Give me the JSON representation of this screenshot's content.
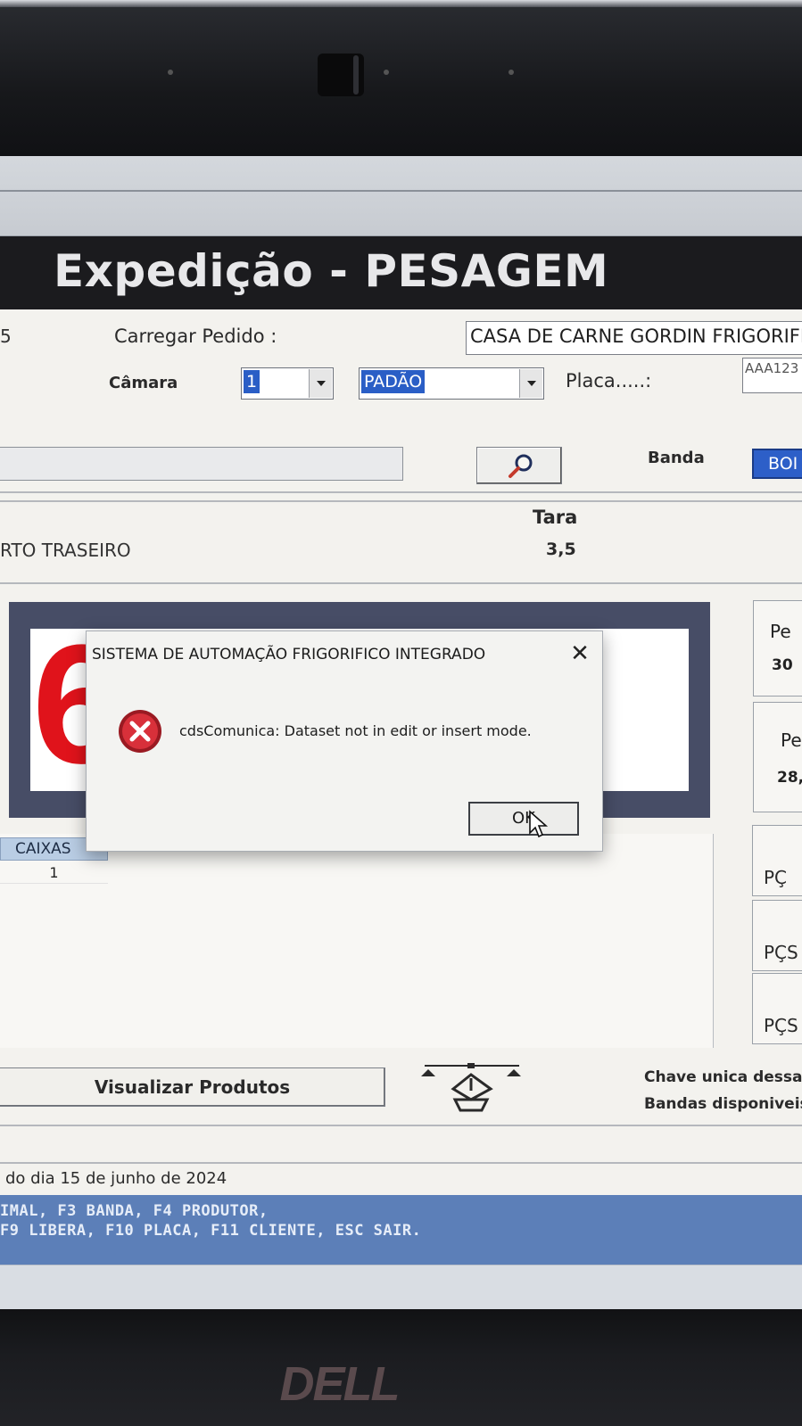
{
  "brand": {
    "logo_text": "DELL"
  },
  "app": {
    "title": "Expedição - PESAGEM",
    "left_partial_digit": "5",
    "carregar_pedido_label": "Carregar Pedido :",
    "client_value": "CASA DE CARNE GORDIN FRIGORIFICO",
    "camara_label": "Câmara",
    "camara_value": "1",
    "tipo_value": "PADÃO",
    "placa_label": "Placa.....:",
    "placa_value": "AAA123",
    "search_icon": "magnifier-icon",
    "banda_label": "Banda",
    "banda_value": "BOI",
    "tara_label": "Tara",
    "product_text": "RTO TRASEIRO",
    "tara_value": "3,5",
    "weight_digit": "6",
    "side_panels": [
      {
        "title": "Pe",
        "value": "30"
      },
      {
        "title": "Pe",
        "value": "28,"
      }
    ],
    "grid": {
      "header": "CAIXAS",
      "rows": [
        "1"
      ]
    },
    "pcs_labels": [
      "PÇ",
      "PÇS",
      "PÇS"
    ],
    "visualizar_label": "Visualizar Produtos",
    "chave_line1": "Chave unica dessa",
    "chave_line2": "Bandas disponiveis",
    "date_text": "do dia  15 de junho de 2024",
    "shortcuts_line1": "IMAL, F3 BANDA, F4  PRODUTOR,",
    "shortcuts_line2": "F9 LIBERA, F10 PLACA, F11 CLIENTE, ESC SAIR."
  },
  "dialog": {
    "title": "SISTEMA DE AUTOMAÇÃO FRIGORIFICO INTEGRADO",
    "close_glyph": "✕",
    "icon": "error-icon",
    "message": "cdsComunica: Dataset not in edit or insert mode.",
    "ok_label": "OK"
  },
  "colors": {
    "error_red": "#c8202b",
    "weight_red": "#e0131b",
    "selection_blue": "#2a5ec6",
    "status_bar": "#5c7fb8",
    "title_bar": "#1b1b1e"
  }
}
